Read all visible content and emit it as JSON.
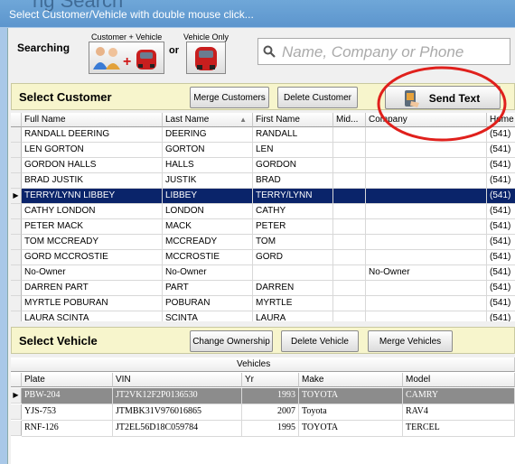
{
  "window": {
    "background_title": "ng Search",
    "title": "Select Customer/Vehicle with double mouse click..."
  },
  "search": {
    "label": "Searching",
    "mode_customer_vehicle": "Customer + Vehicle",
    "or_text": "or",
    "mode_vehicle_only": "Vehicle Only",
    "placeholder": "Name, Company or Phone"
  },
  "customer_section": {
    "title": "Select Customer",
    "merge_button": "Merge Customers",
    "delete_button": "Delete Customer",
    "send_text_button": "Send Text",
    "columns": [
      "Full Name",
      "Last Name",
      "First Name",
      "Mid...",
      "Company",
      "Home"
    ],
    "rows": [
      [
        "RANDALL DEERING",
        "DEERING",
        "RANDALL",
        "",
        "",
        "(541)"
      ],
      [
        "LEN GORTON",
        "GORTON",
        "LEN",
        "",
        "",
        "(541)"
      ],
      [
        "GORDON HALLS",
        "HALLS",
        "GORDON",
        "",
        "",
        "(541)"
      ],
      [
        "BRAD JUSTIK",
        "JUSTIK",
        "BRAD",
        "",
        "",
        "(541)"
      ],
      [
        "TERRY/LYNN LIBBEY",
        "LIBBEY",
        "TERRY/LYNN",
        "",
        "",
        "(541)"
      ],
      [
        "CATHY LONDON",
        "LONDON",
        "CATHY",
        "",
        "",
        "(541)"
      ],
      [
        "PETER MACK",
        "MACK",
        "PETER",
        "",
        "",
        "(541)"
      ],
      [
        "TOM MCCREADY",
        "MCCREADY",
        "TOM",
        "",
        "",
        "(541)"
      ],
      [
        "GORD MCCROSTIE",
        "MCCROSTIE",
        "GORD",
        "",
        "",
        "(541)"
      ],
      [
        "No-Owner",
        "No-Owner",
        "",
        "",
        "No-Owner",
        "(541)"
      ],
      [
        "DARREN PART",
        "PART",
        "DARREN",
        "",
        "",
        "(541)"
      ],
      [
        "MYRTLE POBURAN",
        "POBURAN",
        "MYRTLE",
        "",
        "",
        "(541)"
      ],
      [
        "LAURA SCINTA",
        "SCINTA",
        "LAURA",
        "",
        "",
        "(541)"
      ]
    ]
  },
  "vehicle_section": {
    "title": "Select Vehicle",
    "change_ownership_button": "Change Ownership",
    "delete_button": "Delete Vehicle",
    "merge_button": "Merge Vehicles",
    "group_header": "Vehicles",
    "columns": [
      "Plate",
      "VIN",
      "Yr",
      "Make",
      "Model"
    ],
    "rows": [
      [
        "PBW-204",
        "JT2VK12F2P0136530",
        "1993",
        "TOYOTA",
        "CAMRY"
      ],
      [
        "YJS-753",
        "JTMBK31V976016865",
        "2007",
        "Toyota",
        "RAV4"
      ],
      [
        "RNF-126",
        "JT2EL56D18C059784",
        "1995",
        "TOYOTA",
        "TERCEL"
      ]
    ]
  },
  "colors": {
    "selected_row": "#0a246a",
    "selected_vehicle_row": "#8c8c8c",
    "section_header": "#f7f5cc",
    "annotation_circle": "#e0201c"
  },
  "icons": [
    "people-plus-car-icon",
    "red-car-icon",
    "magnifier-icon",
    "sort-arrow-icon",
    "phone-icon"
  ]
}
